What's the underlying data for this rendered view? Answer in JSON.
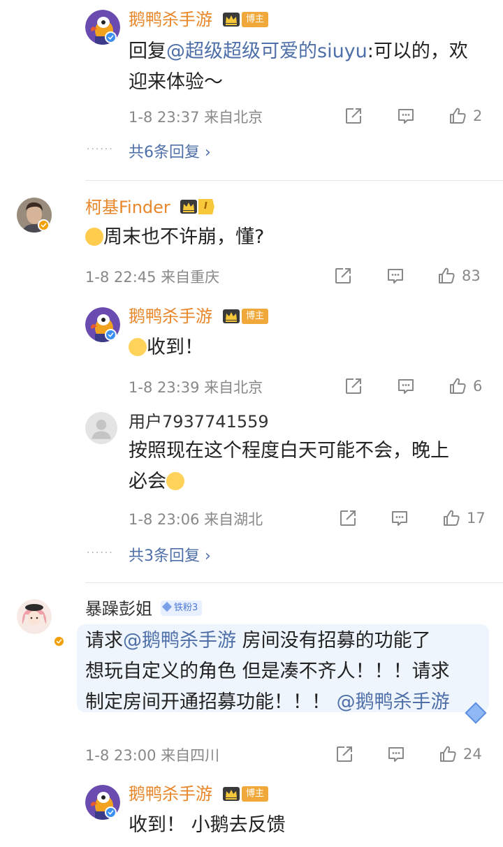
{
  "accent": "#4e6fa8",
  "name_color": "#e8862a",
  "comments": [
    {
      "reply": {
        "name": "鹅鸭杀手游",
        "tag": "博主",
        "prefix": "回复",
        "mention": "@超级超级可爱的siuyu",
        "text_line1": ":可以的，欢",
        "text_line2": "迎来体验～",
        "meta": "1-8 23:37  来自北京",
        "likes": "2"
      },
      "more": "共6条回复 ›"
    },
    {
      "name": "柯基Finder",
      "level": "I",
      "text": "周末也不许崩，懂?",
      "meta": "1-8 22:45  来自重庆",
      "likes": "83",
      "replies": [
        {
          "name": "鹅鸭杀手游",
          "tag": "博主",
          "text": "收到！",
          "meta": "1-8 23:39  来自北京",
          "likes": "6"
        },
        {
          "name": "用户7937741559",
          "text_line1": "按照现在这个程度白天可能不会，晚上",
          "text_line2": "必会",
          "meta": "1-8 23:06  来自湖北",
          "likes": "17"
        }
      ],
      "more": "共3条回复 ›"
    },
    {
      "name": "暴躁彭姐",
      "fan_badge": "铁粉3",
      "pre1": "请求",
      "mention1": "@鹅鸭杀手游",
      "post1": " 房间没有招募的功能了",
      "line2": "想玩自定义的角色 但是凑不齐人！！！请求",
      "line3": "制定房间开通招募功能！！！ ",
      "mention2": "@鹅鸭杀手游",
      "meta": "1-8 23:00  来自四川",
      "likes": "24",
      "reply": {
        "name": "鹅鸭杀手游",
        "tag": "博主",
        "text": "收到！ 小鹅去反馈"
      }
    }
  ],
  "icons": {
    "share": "share-icon",
    "comment": "comment-icon",
    "like": "like-icon",
    "verified": "verified-icon",
    "crown": "crown-icon"
  }
}
